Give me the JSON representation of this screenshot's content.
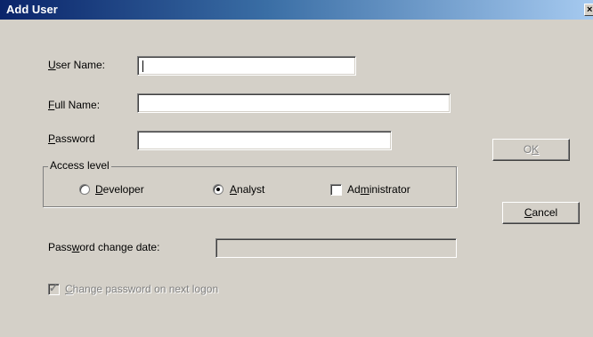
{
  "window": {
    "title": "Add User",
    "close_glyph": "×"
  },
  "form": {
    "user_name": {
      "label_mnemonic": "U",
      "label_rest": "ser Name:",
      "value": ""
    },
    "full_name": {
      "label_mnemonic": "F",
      "label_rest": "ull Name:",
      "value": ""
    },
    "password": {
      "label_mnemonic": "P",
      "label_rest": "assword",
      "value": ""
    },
    "access_level": {
      "legend": "Access level",
      "developer": {
        "pre": "",
        "mnemonic": "D",
        "post": "eveloper",
        "selected": false
      },
      "analyst": {
        "pre": "",
        "mnemonic": "A",
        "post": "nalyst",
        "selected": true
      },
      "administrator": {
        "pre": "Ad",
        "mnemonic": "m",
        "post": "inistrator",
        "checked": false
      }
    },
    "password_change_date": {
      "label_pre": "Pass",
      "label_mnemonic": "w",
      "label_post": "ord change date:",
      "value": ""
    },
    "change_password": {
      "label_mnemonic": "C",
      "label_rest": "hange password on next logon",
      "checked": true,
      "enabled": false
    }
  },
  "buttons": {
    "ok": {
      "pre": "O",
      "mnemonic": "K",
      "post": "",
      "enabled": false
    },
    "cancel": {
      "pre": "",
      "mnemonic": "C",
      "post": "ancel",
      "enabled": true
    }
  },
  "icons": {
    "radio": "radio-icon",
    "checkbox": "checkbox-icon",
    "close": "close-icon"
  },
  "colors": {
    "titlebar_start": "#0a246a",
    "titlebar_end": "#a6caf0",
    "dialog_bg": "#d4d0c8"
  }
}
